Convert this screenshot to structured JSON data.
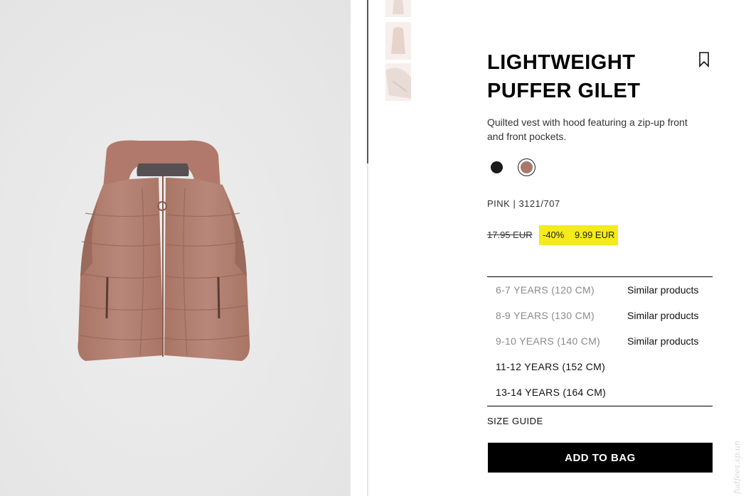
{
  "product": {
    "title_line1": "LIGHTWEIGHT",
    "title_line2": "PUFFER GILET",
    "description": "Quilted vest with hood featuring a zip-up front and front pockets.",
    "color_code": "PINK | 3121/707",
    "old_price": "17.95 EUR",
    "discount": "-40%",
    "new_price": "9.99 EUR",
    "colors": [
      {
        "name": "black",
        "hex": "#1a1a1a"
      },
      {
        "name": "pink",
        "hex": "#a9796c",
        "selected": true
      }
    ],
    "highlight_color": "#f4ea1c"
  },
  "sizes": [
    {
      "label": "6-7 YEARS (120 CM)",
      "available": false,
      "similar": "Similar products"
    },
    {
      "label": "8-9 YEARS (130 CM)",
      "available": false,
      "similar": "Similar products"
    },
    {
      "label": "9-10 YEARS (140 CM)",
      "available": false,
      "similar": "Similar products"
    },
    {
      "label": "11-12 YEARS (152 CM)",
      "available": true
    },
    {
      "label": "13-14 YEARS (164 CM)",
      "available": true
    }
  ],
  "size_guide_label": "SIZE GUIDE",
  "add_to_bag_label": "ADD TO BAG",
  "watermark": "fudfees.sp.un",
  "icons": {
    "bookmark": "bookmark-icon"
  }
}
